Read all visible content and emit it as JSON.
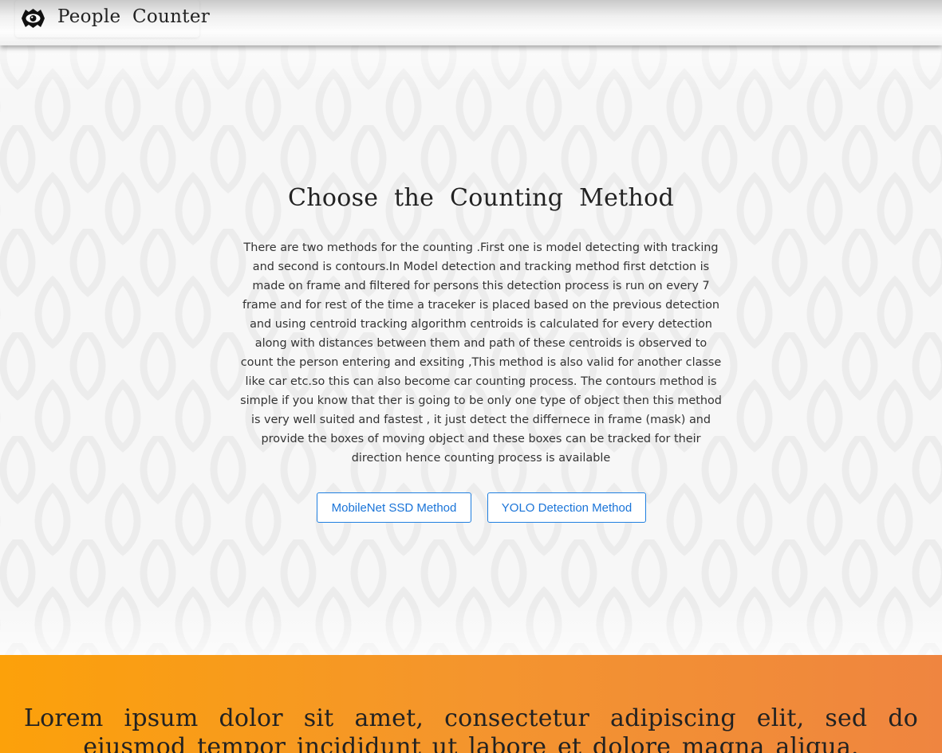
{
  "navbar": {
    "brand_icon": "eye-logo-icon",
    "brand_text": "People Counter"
  },
  "hero": {
    "title": "Choose the Counting Method",
    "description": "There are two methods for the counting .First one is model detecting with tracking and second is contours.In Model detection and tracking method first detction is made on frame and filtered for persons this detection process is run on every 7 frame and for rest of the time a traceker is placed based on the previous detection and using centroid tracking algorithm centroids is calculated for every detection along with distances between them and path of these centroids is observed to count the person entering and exsiting ,This method is also valid for another classe like car etc.so this can also become car counting process. The contours method is simple if you know that ther is going to be only one type of object then this method is very well suited and fastest , it just detect the differnece in frame (mask) and provide the boxes of moving object and these boxes can be tracked for their direction hence counting process is available",
    "buttons": {
      "mobilenet_label": "MobileNet SSD Method",
      "yolo_label": "YOLO Detection Method"
    }
  },
  "footer": {
    "text": "Lorem ipsum dolor sit amet, consectetur adipiscing elit, sed do eiusmod tempor incididunt ut labore et dolore magna aliqua."
  },
  "colors": {
    "accent": "#1a74d8",
    "footer_start": "#fca10a",
    "footer_end": "#ef8540",
    "hero_background": "#f7f7f7"
  }
}
